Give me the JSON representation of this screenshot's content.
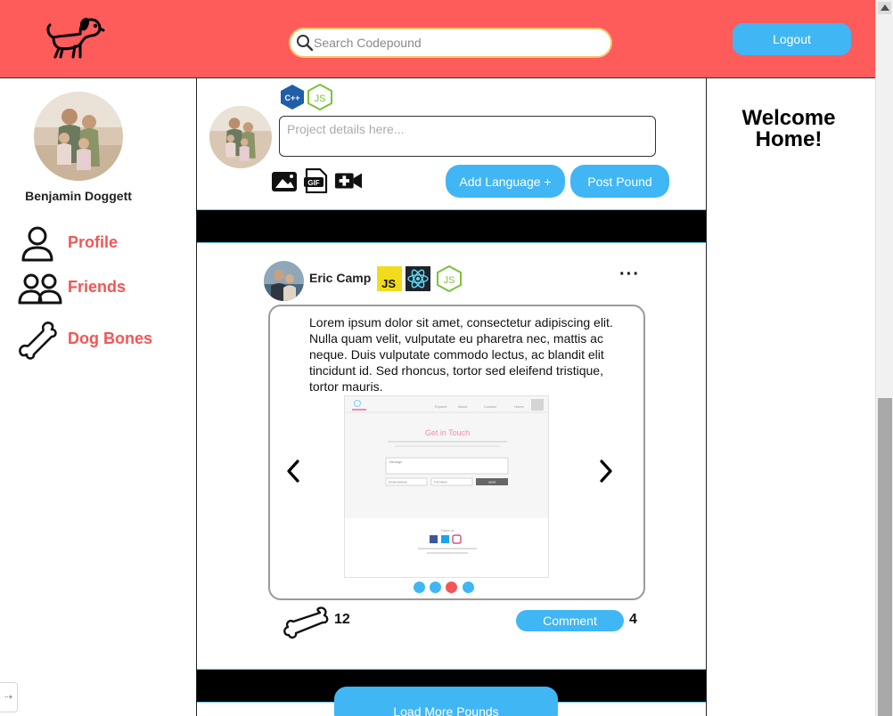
{
  "header": {
    "logo": "dog-logo",
    "search_placeholder": "Search Codepound",
    "logout_label": "Logout"
  },
  "user": {
    "name": "Benjamin Doggett"
  },
  "nav": [
    {
      "label": "Profile",
      "icon": "person-icon"
    },
    {
      "label": "Friends",
      "icon": "friends-icon"
    },
    {
      "label": "Dog Bones",
      "icon": "bone-icon"
    }
  ],
  "composer": {
    "languages": [
      "C++",
      "JS"
    ],
    "placeholder": "Project details here...",
    "media_icons": [
      "image-icon",
      "gif-icon",
      "video-icon"
    ],
    "add_language_label": "Add Language +",
    "post_label": "Post Pound"
  },
  "post": {
    "author": "Eric Camp",
    "languages": [
      "JS",
      "React",
      "Node"
    ],
    "more": "···",
    "body": "Lorem ipsum dolor sit amet, consectetur adipiscing elit. Nulla quam velit, vulputate eu pharetra nec, mattis ac neque. Duis vulputate commodo lectus, ac blandit elit tincidunt id. Sed rhoncus, tortor sed eleifend tristique, tortor mauris.",
    "screenshot": {
      "nav": [
        "Explore",
        "About",
        "Contact",
        "Home"
      ],
      "title": "Get in Touch",
      "message_placeholder": "Message",
      "email_placeholder": "Email Address",
      "name_placeholder": "Full Name",
      "send": "send",
      "footer_follow": "Follow us"
    },
    "carousel": {
      "count": 4,
      "active_index": 2
    },
    "likes": "12",
    "comment_label": "Comment",
    "comments": "4"
  },
  "load_more_label": "Load More Pounds",
  "right": {
    "welcome_line1": "Welcome",
    "welcome_line2": "Home!"
  },
  "colors": {
    "header_bg": "#fe5b5b",
    "accent_blue": "#40b6f5",
    "nav_red": "#f25656",
    "search_border": "#f5c46a"
  }
}
